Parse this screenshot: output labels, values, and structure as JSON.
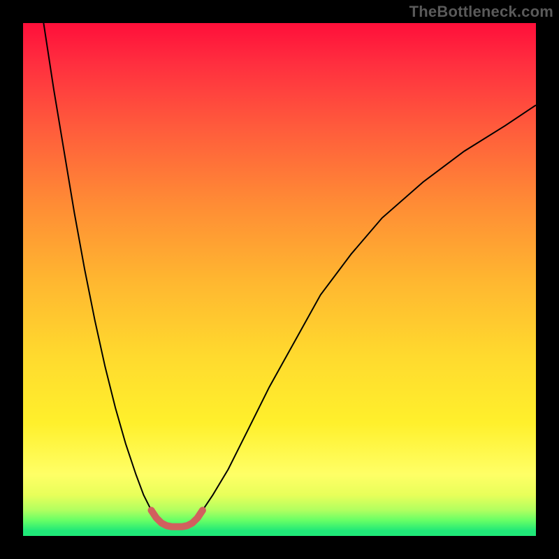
{
  "attribution": {
    "text": "TheBottleneck.com"
  },
  "chart_data": {
    "type": "line",
    "title": "",
    "xlabel": "",
    "ylabel": "",
    "xlim": [
      0,
      100
    ],
    "ylim": [
      0,
      100
    ],
    "grid": false,
    "legend": false,
    "background": {
      "type": "vertical-gradient",
      "stops": [
        {
          "pos": 0,
          "color": "#ff0f3a"
        },
        {
          "pos": 8,
          "color": "#ff2f3f"
        },
        {
          "pos": 20,
          "color": "#ff5a3c"
        },
        {
          "pos": 35,
          "color": "#ff8b35"
        },
        {
          "pos": 50,
          "color": "#ffb630"
        },
        {
          "pos": 65,
          "color": "#ffda2e"
        },
        {
          "pos": 78,
          "color": "#fff02c"
        },
        {
          "pos": 88,
          "color": "#ffff66"
        },
        {
          "pos": 92,
          "color": "#e8ff5a"
        },
        {
          "pos": 95,
          "color": "#b0ff60"
        },
        {
          "pos": 97,
          "color": "#66ff66"
        },
        {
          "pos": 100,
          "color": "#20e878"
        }
      ]
    },
    "series": [
      {
        "name": "curve-left",
        "color": "#000000",
        "width": 2,
        "x": [
          4,
          6,
          8,
          10,
          12,
          14,
          16,
          18,
          20,
          22,
          23.5,
          25,
          26,
          27
        ],
        "y": [
          100,
          87,
          75,
          63,
          52,
          42,
          33,
          25,
          18,
          12,
          8,
          5,
          3.5,
          2.5
        ]
      },
      {
        "name": "curve-right",
        "color": "#000000",
        "width": 2,
        "x": [
          33,
          34,
          35,
          37,
          40,
          44,
          48,
          53,
          58,
          64,
          70,
          78,
          86,
          94,
          100
        ],
        "y": [
          2.5,
          3.5,
          5,
          8,
          13,
          21,
          29,
          38,
          47,
          55,
          62,
          69,
          75,
          80,
          84
        ]
      },
      {
        "name": "mark",
        "color": "#d1605e",
        "width": 10,
        "linecap": "round",
        "x": [
          25,
          26,
          27,
          28,
          29,
          30,
          31,
          32,
          33,
          34,
          35
        ],
        "y": [
          5,
          3.5,
          2.5,
          2,
          1.8,
          1.8,
          1.8,
          2,
          2.5,
          3.5,
          5
        ]
      }
    ]
  }
}
